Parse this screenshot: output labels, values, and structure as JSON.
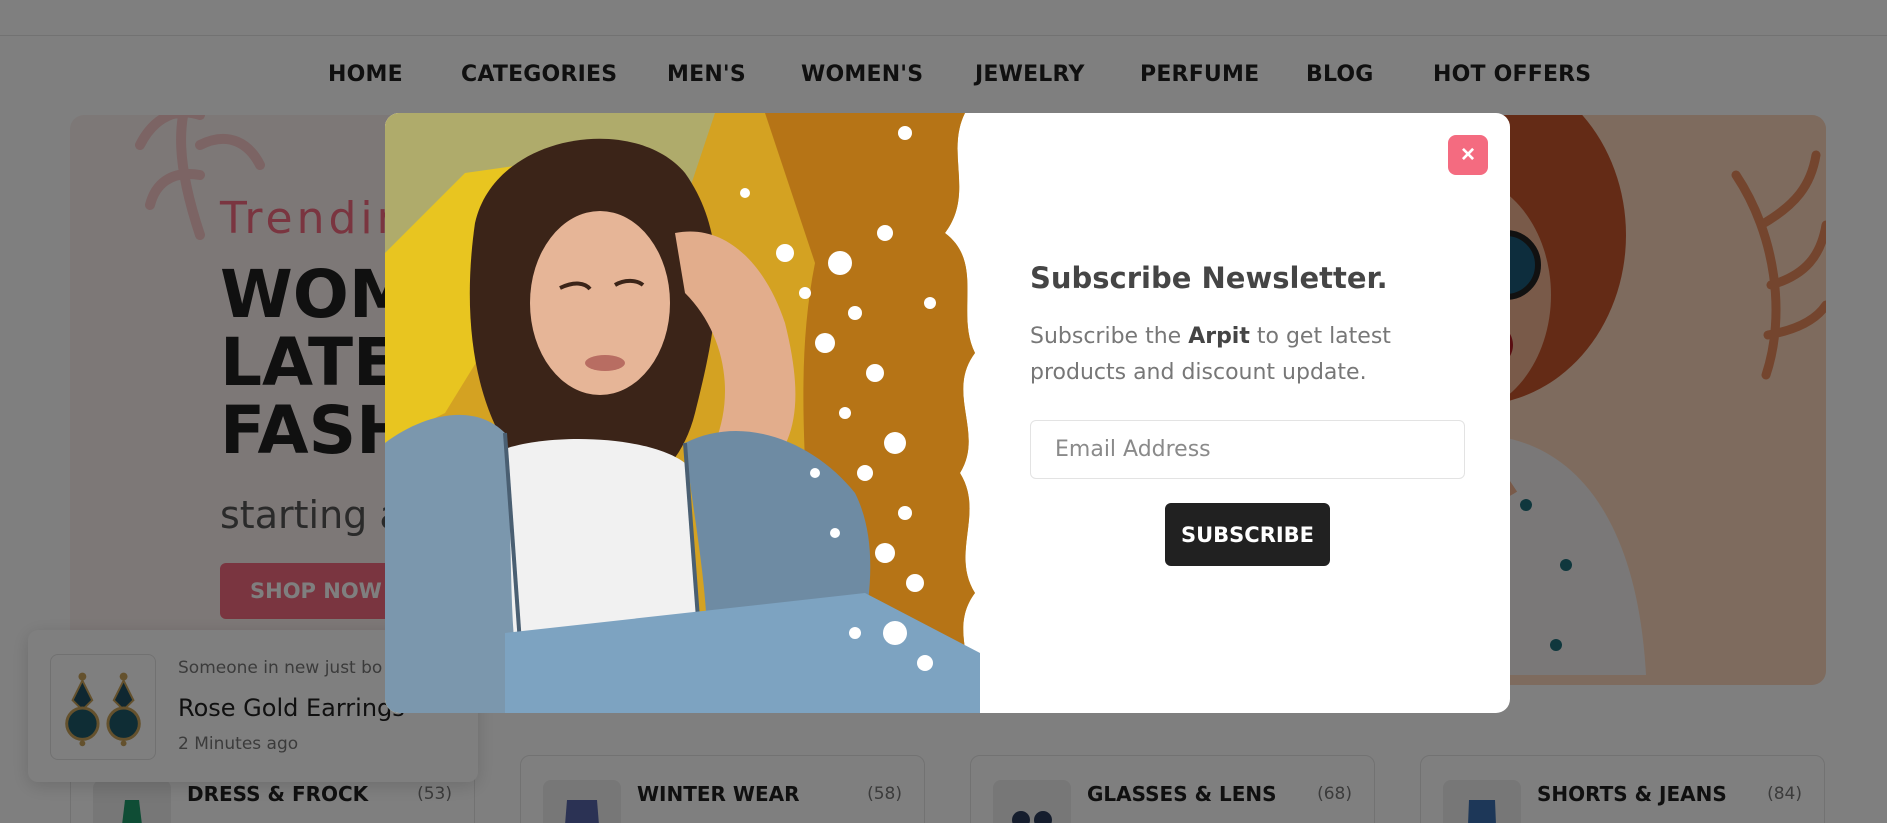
{
  "nav": {
    "items": [
      {
        "label": "HOME"
      },
      {
        "label": "CATEGORIES"
      },
      {
        "label": "MEN'S"
      },
      {
        "label": "WOMEN'S"
      },
      {
        "label": "JEWELRY"
      },
      {
        "label": "PERFUME"
      },
      {
        "label": "BLOG"
      },
      {
        "label": "HOT OFFERS"
      }
    ]
  },
  "hero": {
    "subtitle": "Trendin",
    "title_lines": [
      "WOM",
      "LATES",
      "FASH"
    ],
    "price_text": "starting a",
    "button_label": "SHOP NOW"
  },
  "categories": [
    {
      "name": "DRESS & FROCK",
      "count": "(53)"
    },
    {
      "name": "WINTER WEAR",
      "count": "(58)"
    },
    {
      "name": "GLASSES & LENS",
      "count": "(68)"
    },
    {
      "name": "SHORTS & JEANS",
      "count": "(84)"
    }
  ],
  "toast": {
    "line1": "Someone in new just bo",
    "title": "Rose Gold Earrings",
    "time": "2 Minutes ago"
  },
  "modal": {
    "close_label": "×",
    "title": "Subscribe Newsletter.",
    "text_before": "Subscribe the ",
    "brand": "Arpit",
    "text_after": " to get latest products and discount update.",
    "email_placeholder": "Email Address",
    "email_value": "",
    "subscribe_label": "SUBSCRIBE"
  },
  "colors": {
    "accent": "#f46b80",
    "dark": "#212121",
    "overlay": "rgba(0,0,0,0.5)"
  }
}
